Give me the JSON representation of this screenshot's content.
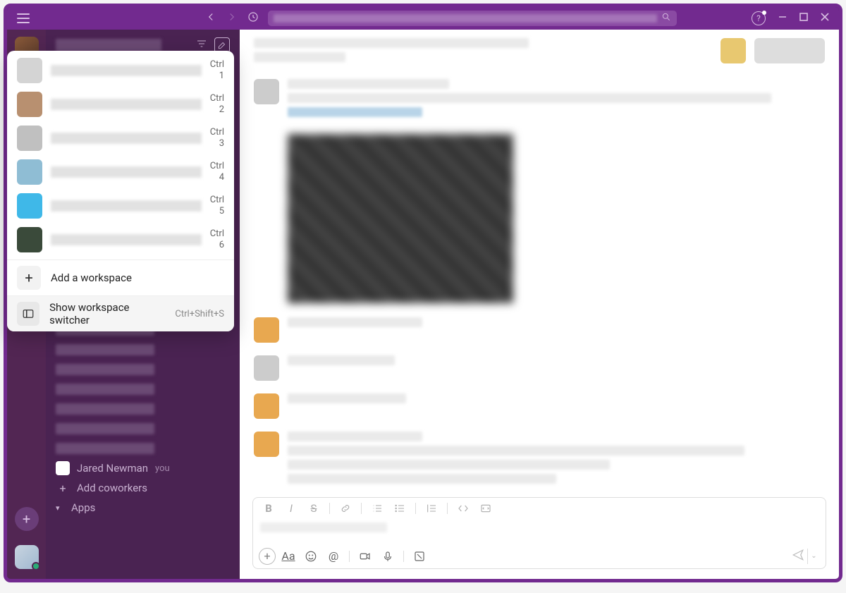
{
  "titlebar": {
    "search_placeholder": ""
  },
  "sidebar": {
    "dm_user": "Jared Newman",
    "you_label": "you",
    "add_coworkers": "Add coworkers",
    "apps_section": "Apps"
  },
  "workspace_switcher": {
    "items": [
      {
        "shortcut_key": "Ctrl",
        "shortcut_num": "1",
        "color": "ws-color-1"
      },
      {
        "shortcut_key": "Ctrl",
        "shortcut_num": "2",
        "color": "ws-color-2"
      },
      {
        "shortcut_key": "Ctrl",
        "shortcut_num": "3",
        "color": "ws-color-3"
      },
      {
        "shortcut_key": "Ctrl",
        "shortcut_num": "4",
        "color": "ws-color-4"
      },
      {
        "shortcut_key": "Ctrl",
        "shortcut_num": "5",
        "color": "ws-color-5"
      },
      {
        "shortcut_key": "Ctrl",
        "shortcut_num": "6",
        "color": "ws-color-6"
      }
    ],
    "add_workspace": "Add a workspace",
    "show_switcher": "Show workspace switcher",
    "show_switcher_shortcut": "Ctrl+Shift+S"
  }
}
